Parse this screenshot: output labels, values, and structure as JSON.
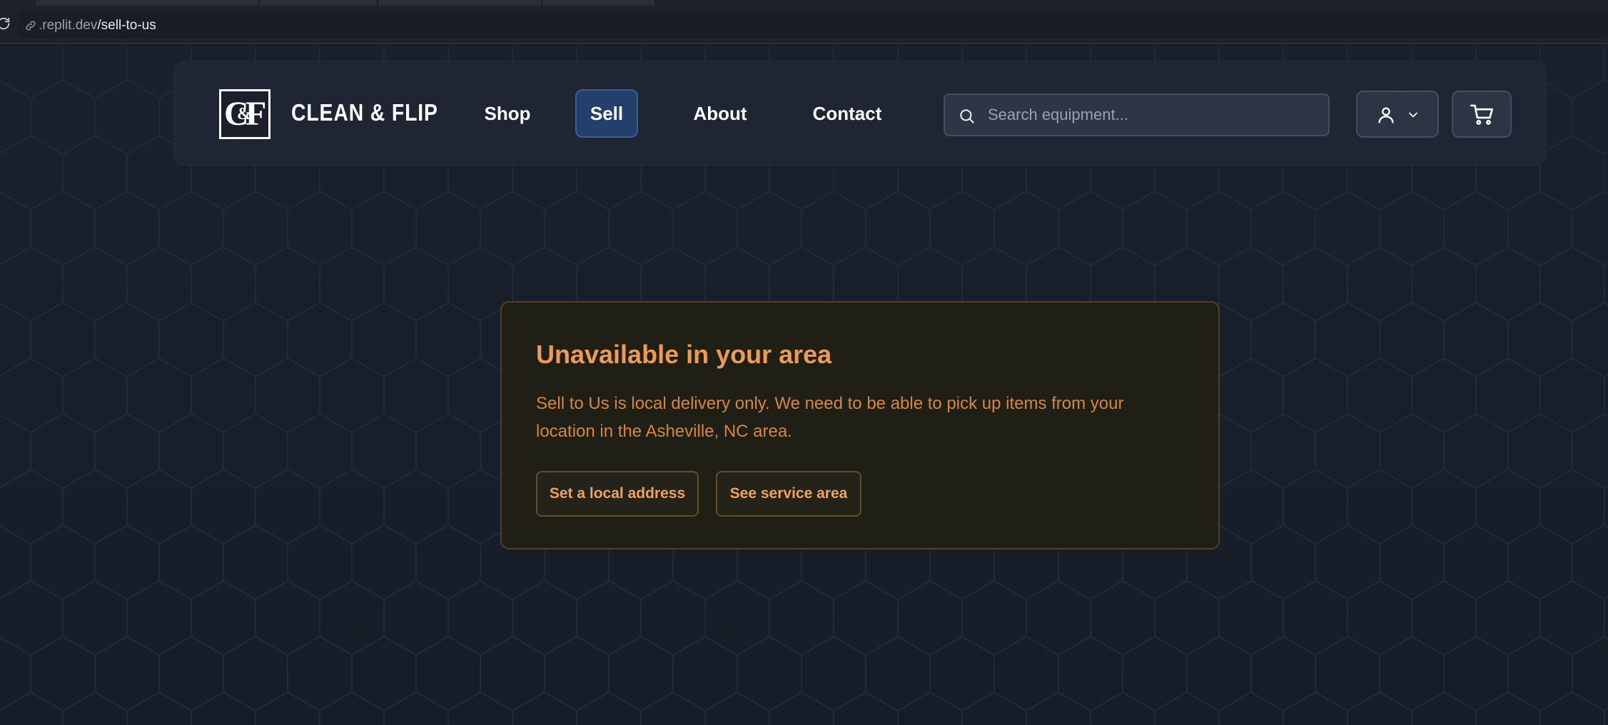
{
  "browser": {
    "url_domain": ".replit.dev",
    "url_path": "/sell-to-us"
  },
  "header": {
    "logo_left": "C",
    "logo_amp": "&",
    "logo_right": "F",
    "brand_name": "CLEAN & FLIP",
    "nav": {
      "shop": "Shop",
      "sell": "Sell",
      "about": "About",
      "contact": "Contact"
    },
    "active_nav": "Sell",
    "search": {
      "placeholder": "Search equipment...",
      "value": ""
    },
    "icons": {
      "search": "search-icon",
      "account": "user-icon",
      "account_menu": "chevron-down-icon",
      "cart": "cart-icon"
    }
  },
  "alert": {
    "title": "Unavailable in your area",
    "message": "Sell to Us is local delivery only. We need to be able to pick up items from your location in the Asheville, NC area.",
    "buttons": {
      "set_address": "Set a local address",
      "service_area": "See service area"
    }
  },
  "colors": {
    "page_bg": "#1a202c",
    "active_nav_bg": "#23406c",
    "alert_bg": "#201f15",
    "alert_text": "#ec9b54"
  }
}
